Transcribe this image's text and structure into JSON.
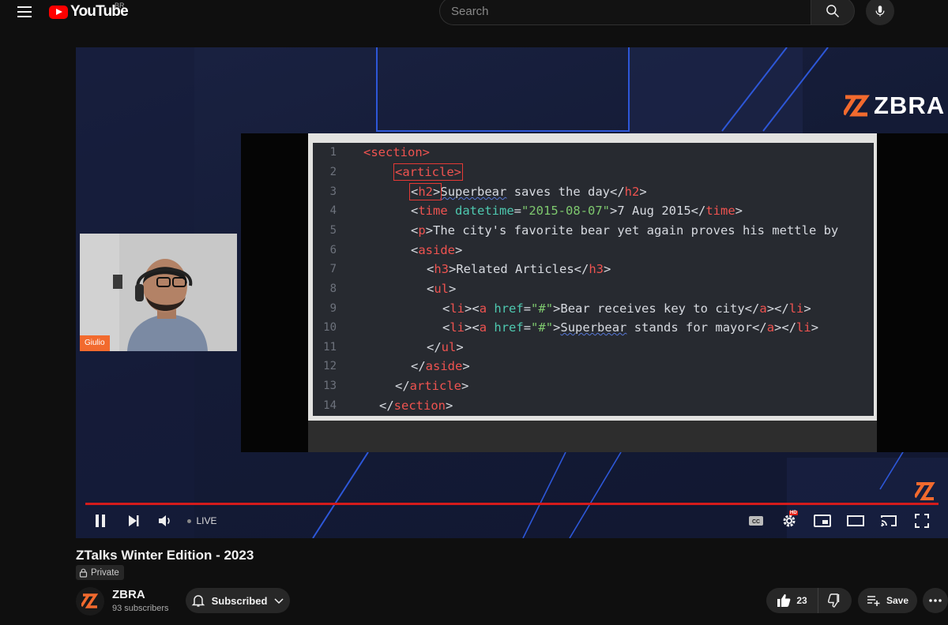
{
  "header": {
    "logo_text": "YouTube",
    "country_code": "BR",
    "search": {
      "placeholder": "Search",
      "value": ""
    }
  },
  "player": {
    "brand": "ZBRA",
    "webcam_name": "Giulio",
    "live_label": "LIVE",
    "progress": 1.0,
    "code_lines": [
      {
        "n": "1",
        "code": "<section>"
      },
      {
        "n": "2",
        "code": "<article>"
      },
      {
        "n": "3",
        "code": "<h2>Superbear saves the day</h2>"
      },
      {
        "n": "4",
        "code": "<time datetime=\"2015-08-07\">7 Aug 2015</time>"
      },
      {
        "n": "5",
        "code": "<p>The city's favorite bear yet again proves his mettle by"
      },
      {
        "n": "6",
        "code": "<aside>"
      },
      {
        "n": "7",
        "code": "<h3>Related Articles</h3>"
      },
      {
        "n": "8",
        "code": "<ul>"
      },
      {
        "n": "9",
        "code": "<li><a href=\"#\">Bear receives key to city</a></li>"
      },
      {
        "n": "10",
        "code": "<li><a href=\"#\">Superbear stands for mayor</a></li>"
      },
      {
        "n": "11",
        "code": "</ul>"
      },
      {
        "n": "12",
        "code": "</aside>"
      },
      {
        "n": "13",
        "code": "</article>"
      },
      {
        "n": "14",
        "code": "</section>"
      }
    ],
    "colors": {
      "accent": "#f26a2e",
      "progress": "#d41b1b",
      "tag": "#ef5350",
      "attr": "#4ec9b0",
      "string": "#7ec86e"
    }
  },
  "video": {
    "title": "ZTalks Winter Edition - 2023",
    "privacy": "Private"
  },
  "channel": {
    "name": "ZBRA",
    "subscribers": "93 subscribers",
    "subscribe_label": "Subscribed"
  },
  "actions": {
    "like_count": "23",
    "save_label": "Save"
  },
  "icons": [
    "menu-icon",
    "youtube-logo-icon",
    "search-icon",
    "mic-icon",
    "pause-icon",
    "next-icon",
    "volume-icon",
    "cc-icon",
    "settings-icon",
    "miniplayer-icon",
    "theater-icon",
    "cast-icon",
    "fullscreen-icon",
    "lock-icon",
    "bell-icon",
    "chevron-down-icon",
    "like-icon",
    "dislike-icon",
    "add-to-playlist-icon",
    "more-icon"
  ]
}
